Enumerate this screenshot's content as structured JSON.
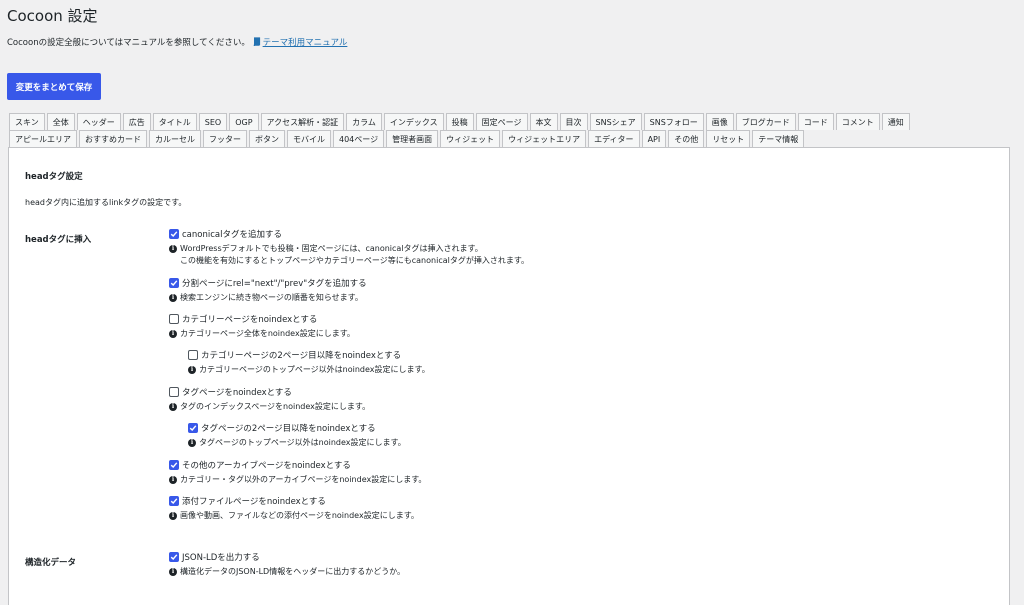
{
  "page": {
    "title": "Cocoon 設定",
    "intro_text": "Cocoonの設定全般についてはマニュアルを参照してください。",
    "manual_link": "テーマ利用マニュアル",
    "save_button": "変更をまとめて保存"
  },
  "tabs_row1": [
    "スキン",
    "全体",
    "ヘッダー",
    "広告",
    "タイトル",
    "SEO",
    "OGP",
    "アクセス解析・認証",
    "カラム",
    "インデックス",
    "投稿",
    "固定ページ",
    "本文",
    "目次",
    "SNSシェア",
    "SNSフォロー",
    "画像",
    "ブログカード",
    "コード",
    "コメント",
    "通知"
  ],
  "tabs_row2": [
    "アピールエリア",
    "おすすめカード",
    "カルーセル",
    "フッター",
    "ボタン",
    "モバイル",
    "404ページ",
    "管理者画面",
    "ウィジェット",
    "ウィジェットエリア",
    "エディター",
    "API",
    "その他",
    "リセット",
    "テーマ情報"
  ],
  "section": {
    "title": "headタグ設定",
    "description": "headタグ内に追加するlinkタグの設定です。",
    "label_head": "headタグに挿入",
    "label_structured": "構造化データ"
  },
  "options": {
    "canonical": {
      "label": "canonicalタグを追加する",
      "checked": true,
      "note1": "WordPressデフォルトでも投稿・固定ページには、canonicalタグは挿入されます。",
      "note2": "この機能を有効にするとトップページやカテゴリーページ等にもcanonicalタグが挿入されます。"
    },
    "prev_next": {
      "label": "分割ページにrel=\"next\"/\"prev\"タグを追加する",
      "checked": true,
      "note": "検索エンジンに続き物ページの順番を知らせます。"
    },
    "category_noindex": {
      "label": "カテゴリーページをnoindexとする",
      "checked": false,
      "note": "カテゴリーページ全体をnoindex設定にします。"
    },
    "category_page2_noindex": {
      "label": "カテゴリーページの2ページ目以降をnoindexとする",
      "checked": false,
      "note": "カテゴリーページのトップページ以外はnoindex設定にします。"
    },
    "tag_noindex": {
      "label": "タグページをnoindexとする",
      "checked": false,
      "note": "タグのインデックスページをnoindex設定にします。"
    },
    "tag_page2_noindex": {
      "label": "タグページの2ページ目以降をnoindexとする",
      "checked": true,
      "note": "タグページのトップページ以外はnoindex設定にします。"
    },
    "other_archive_noindex": {
      "label": "その他のアーカイブページをnoindexとする",
      "checked": true,
      "note": "カテゴリー・タグ以外のアーカイブページをnoindex設定にします。"
    },
    "attachment_noindex": {
      "label": "添付ファイルページをnoindexとする",
      "checked": true,
      "note": "画像や動画、ファイルなどの添付ページをnoindex設定にします。"
    },
    "json_ld": {
      "label": "JSON-LDを出力する",
      "checked": true,
      "note": "構造化データのJSON-LD情報をヘッダーに出力するかどうか。"
    }
  },
  "colors": {
    "accent": "#3858e9",
    "link": "#2271b1",
    "background": "#f0f0f1"
  }
}
